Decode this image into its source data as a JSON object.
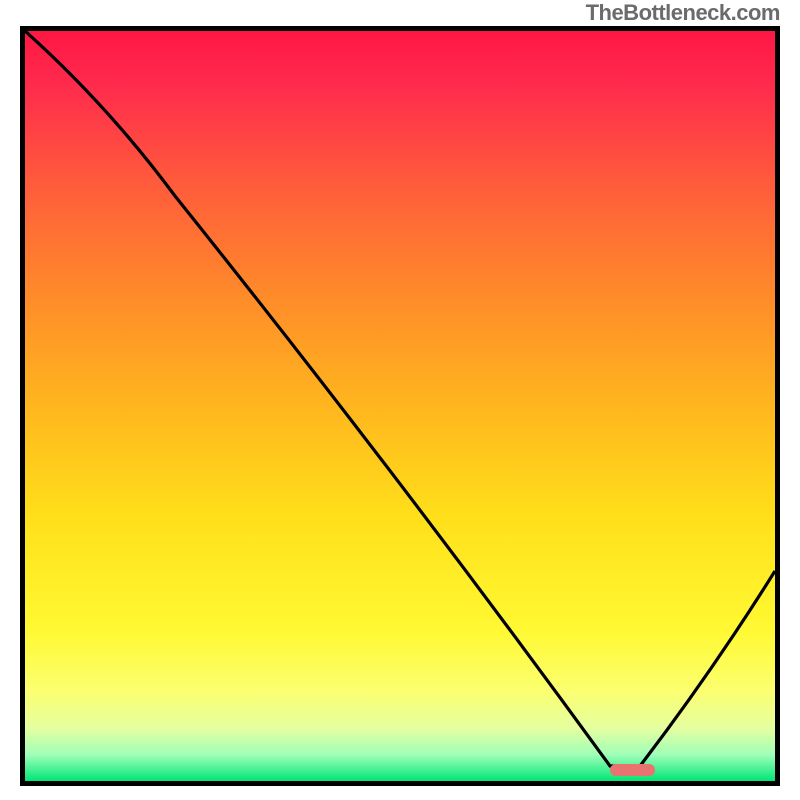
{
  "watermark": "TheBottleneck.com",
  "chart_data": {
    "type": "line",
    "title": "",
    "xlabel": "",
    "ylabel": "",
    "xlim": [
      0,
      100
    ],
    "ylim": [
      0,
      100
    ],
    "series": [
      {
        "name": "curve",
        "x": [
          0,
          20,
          78,
          82,
          100
        ],
        "values": [
          100,
          78,
          2,
          2,
          28
        ]
      }
    ],
    "marker": {
      "x_start": 78,
      "x_end": 84,
      "y": 1.5,
      "color": "#e8736f"
    },
    "background_gradient": {
      "stops": [
        {
          "pos": 0.0,
          "color": "#ff1744"
        },
        {
          "pos": 0.07,
          "color": "#ff2a4d"
        },
        {
          "pos": 0.2,
          "color": "#ff5a3c"
        },
        {
          "pos": 0.35,
          "color": "#ff8a2a"
        },
        {
          "pos": 0.5,
          "color": "#ffb61e"
        },
        {
          "pos": 0.65,
          "color": "#ffe01a"
        },
        {
          "pos": 0.8,
          "color": "#fff933"
        },
        {
          "pos": 0.88,
          "color": "#fcff70"
        },
        {
          "pos": 0.93,
          "color": "#e4ffa0"
        },
        {
          "pos": 0.965,
          "color": "#9fffb8"
        },
        {
          "pos": 1.0,
          "color": "#00e676"
        }
      ]
    }
  }
}
